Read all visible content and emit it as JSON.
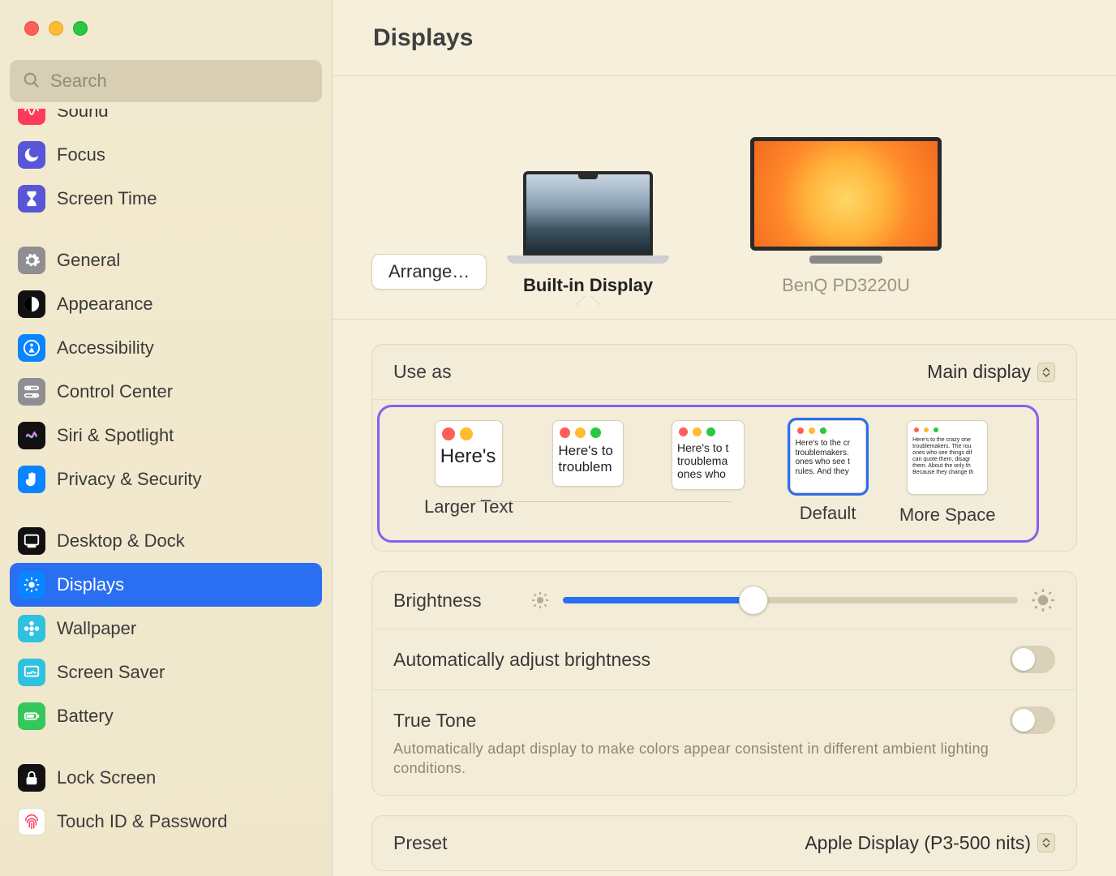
{
  "window": {
    "title": "Displays"
  },
  "search": {
    "placeholder": "Search"
  },
  "sidebar": {
    "items": [
      {
        "id": "sound",
        "label": "Sound",
        "iconBg": "#ff3b5c",
        "glyph": "wave"
      },
      {
        "id": "focus",
        "label": "Focus",
        "iconBg": "#5856d6",
        "glyph": "moon"
      },
      {
        "id": "screentime",
        "label": "Screen Time",
        "iconBg": "#5856d6",
        "glyph": "hourglass"
      },
      {
        "id": "general",
        "label": "General",
        "iconBg": "#8e8e93",
        "glyph": "gear"
      },
      {
        "id": "appearance",
        "label": "Appearance",
        "iconBg": "#111",
        "glyph": "contrast"
      },
      {
        "id": "accessibility",
        "label": "Accessibility",
        "iconBg": "#0a84ff",
        "glyph": "person"
      },
      {
        "id": "controlcenter",
        "label": "Control Center",
        "iconBg": "#8e8e93",
        "glyph": "switches"
      },
      {
        "id": "siri",
        "label": "Siri & Spotlight",
        "iconBg": "#111",
        "glyph": "siri"
      },
      {
        "id": "privacy",
        "label": "Privacy & Security",
        "iconBg": "#0a84ff",
        "glyph": "hand"
      },
      {
        "id": "desktop",
        "label": "Desktop & Dock",
        "iconBg": "#111",
        "glyph": "dock"
      },
      {
        "id": "displays",
        "label": "Displays",
        "iconBg": "#0a84ff",
        "glyph": "brightness",
        "selected": true
      },
      {
        "id": "wallpaper",
        "label": "Wallpaper",
        "iconBg": "#2fc1e0",
        "glyph": "flower"
      },
      {
        "id": "screensaver",
        "label": "Screen Saver",
        "iconBg": "#2fc1e0",
        "glyph": "screensaver"
      },
      {
        "id": "battery",
        "label": "Battery",
        "iconBg": "#34c759",
        "glyph": "battery"
      },
      {
        "id": "lockscreen",
        "label": "Lock Screen",
        "iconBg": "#111",
        "glyph": "lock"
      },
      {
        "id": "touchid",
        "label": "Touch ID & Password",
        "iconBg": "#fff",
        "glyph": "fingerprint"
      }
    ]
  },
  "picker": {
    "arrange_label": "Arrange…",
    "displays": [
      {
        "name": "Built-in Display",
        "selected": true,
        "kind": "laptop"
      },
      {
        "name": "BenQ PD3220U",
        "selected": false,
        "kind": "monitor"
      }
    ]
  },
  "use_as": {
    "label": "Use as",
    "value": "Main display"
  },
  "scaling": {
    "captions": {
      "larger": "Larger Text",
      "default": "Default",
      "more": "More Space"
    },
    "selected_index": 3,
    "sample_text": "Here's to the crazy ones. The troublemakers. The round ones who see things differently. And they have no rules. And they can quote them, disagree with them. About the only thing Because they change things."
  },
  "brightness": {
    "label": "Brightness",
    "value_pct": 42
  },
  "auto_brightness": {
    "label": "Automatically adjust brightness",
    "on": false
  },
  "true_tone": {
    "label": "True Tone",
    "on": false,
    "description": "Automatically adapt display to make colors appear consistent in different ambient lighting conditions."
  },
  "preset": {
    "label": "Preset",
    "value": "Apple Display (P3-500 nits)"
  }
}
